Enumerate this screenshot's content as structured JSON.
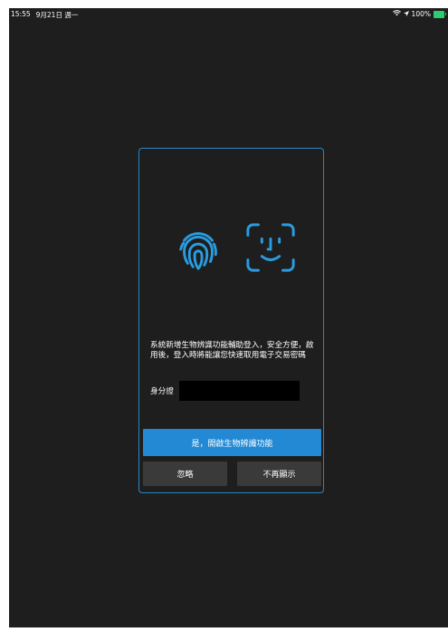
{
  "status_bar": {
    "time": "15:55",
    "date": "9月21日 週一",
    "battery_percent": "100%"
  },
  "dialog": {
    "description": "系統新增生物辨識功能輔助登入，安全方便，啟用後，登入時將能讓您快速取用電子交易密碼",
    "id_label": "身分證",
    "id_value": "",
    "enable_button_label": "是，開啟生物辨識功能",
    "ignore_button_label": "忽略",
    "never_show_button_label": "不再顯示",
    "icons": [
      "fingerprint-icon",
      "face-id-icon"
    ]
  },
  "colors": {
    "accent": "#2389d4",
    "dialog_border": "#2a86c4",
    "background": "#1e1e1e",
    "secondary_button": "#3a3a3a",
    "battery": "#2ecc71"
  }
}
